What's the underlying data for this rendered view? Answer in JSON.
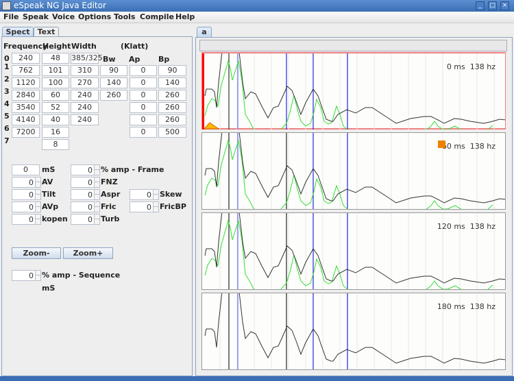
{
  "window": {
    "title": "eSpeak NG Java Editor",
    "minimize_icon": "minimize-icon",
    "maximize_icon": "maximize-icon",
    "close_icon": "close-icon"
  },
  "menu": [
    "File",
    "Speak",
    "Voice",
    "Options",
    "Tools",
    "Compile",
    "Help"
  ],
  "left_tabs": [
    "Spect",
    "Text"
  ],
  "formant_table": {
    "headers": {
      "frequency": "Frequency",
      "height": "Height",
      "width": "Width",
      "klatt": "(Klatt)",
      "bw": "Bw",
      "ap": "Ap",
      "bp": "Bp"
    },
    "row_numbers": [
      "0",
      "1",
      "2",
      "3",
      "4",
      "5",
      "6",
      "7"
    ],
    "frequency": [
      "240",
      "762",
      "1120",
      "2840",
      "3540",
      "4140",
      "7200"
    ],
    "height": [
      "48",
      "101",
      "100",
      "60",
      "52",
      "40",
      "16",
      "8"
    ],
    "width": [
      "385/325",
      "310",
      "270",
      "240",
      "240",
      "240"
    ],
    "bw": [
      "90",
      "140",
      "260"
    ],
    "ap": [
      "0",
      "0",
      "0",
      "0",
      "0",
      "0"
    ],
    "bp": [
      "90",
      "140",
      "260",
      "260",
      "260",
      "500"
    ]
  },
  "params": {
    "ms": {
      "value": "0",
      "label": "mS"
    },
    "amp_frame": {
      "value": "0",
      "label": "% amp - Frame"
    },
    "av": {
      "value": "0",
      "label": "AV"
    },
    "fnz": {
      "value": "0",
      "label": "FNZ"
    },
    "tilt": {
      "value": "0",
      "label": "Tilt"
    },
    "aspr": {
      "value": "0",
      "label": "Aspr"
    },
    "skew": {
      "value": "0",
      "label": "Skew"
    },
    "avp": {
      "value": "0",
      "label": "AVp"
    },
    "fric": {
      "value": "0",
      "label": "Fric"
    },
    "fricbp": {
      "value": "0",
      "label": "FricBP"
    },
    "kopen": {
      "value": "0",
      "label": "kopen"
    },
    "turb": {
      "value": "0",
      "label": "Turb"
    }
  },
  "buttons": {
    "zoom_minus": "Zoom-",
    "zoom_plus": "Zoom+"
  },
  "sequence": {
    "value": "0",
    "label": "% amp - Sequence",
    "ms_label": "mS"
  },
  "right_tab": "a",
  "frames": [
    {
      "label": "0 ms  138 hz",
      "selected": true
    },
    {
      "label": "60 ms  138 hz",
      "marker": true
    },
    {
      "label": "120 ms  138 hz"
    },
    {
      "label": "180 ms  138 hz"
    }
  ],
  "colors": {
    "spectrum": "#333333",
    "peaks": "#33dd33",
    "formant_marker": "#2222ee",
    "selection": "#ff0000",
    "marker": "#f08000"
  }
}
